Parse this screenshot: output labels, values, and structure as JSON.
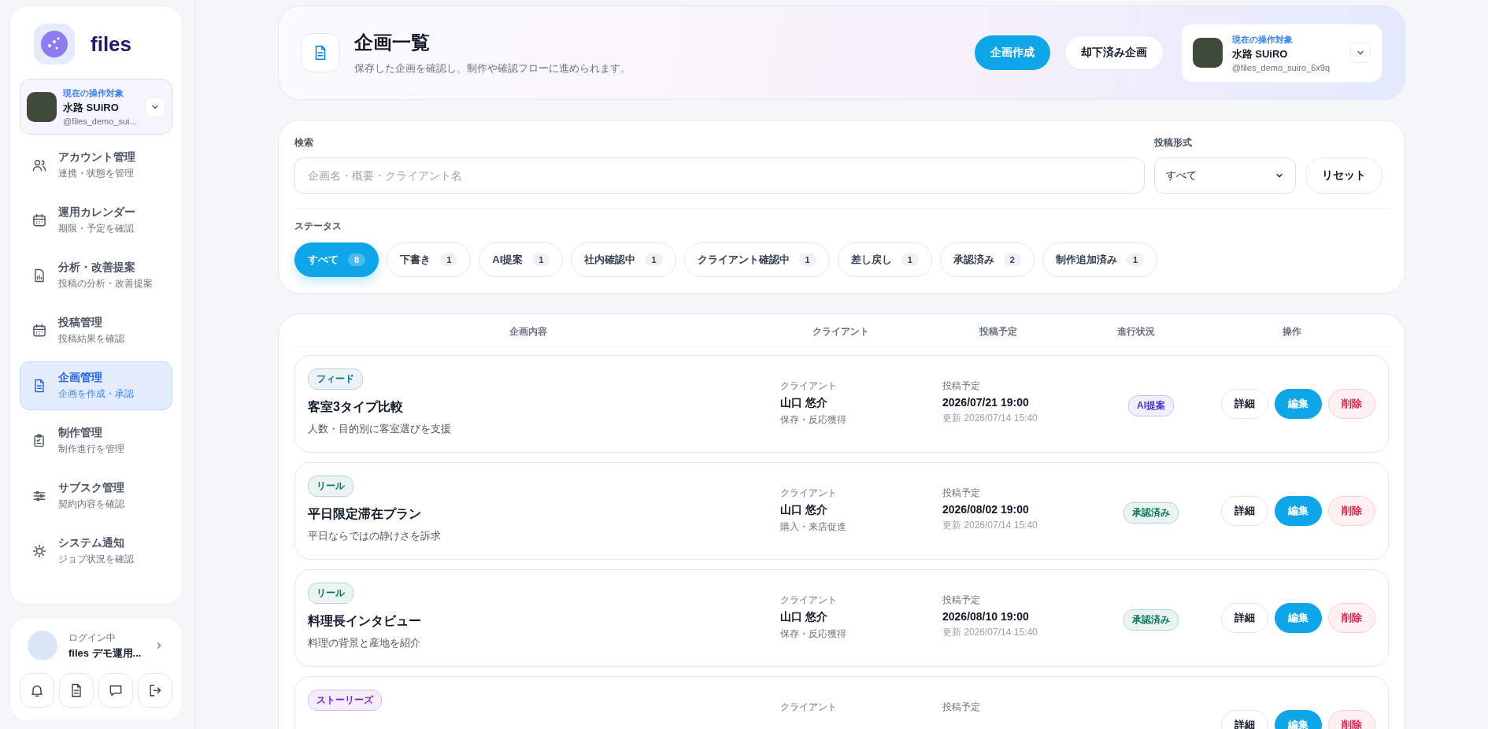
{
  "sidebar": {
    "logo": "files",
    "account": {
      "label": "現在の操作対象",
      "name": "水路 SUiRO",
      "handle": "@files_demo_sui..."
    },
    "items": [
      {
        "title": "アカウント管理",
        "subtitle": "連携・状態を管理",
        "selected": false
      },
      {
        "title": "運用カレンダー",
        "subtitle": "期限・予定を確認",
        "selected": false
      },
      {
        "title": "分析・改善提案",
        "subtitle": "投稿の分析・改善提案",
        "selected": false
      },
      {
        "title": "投稿管理",
        "subtitle": "投稿結果を確認",
        "selected": false
      },
      {
        "title": "企画管理",
        "subtitle": "企画を作成・承認",
        "selected": true
      },
      {
        "title": "制作管理",
        "subtitle": "制作進行を管理",
        "selected": false
      },
      {
        "title": "サブスク管理",
        "subtitle": "契約内容を確認",
        "selected": false
      },
      {
        "title": "システム通知",
        "subtitle": "ジョブ状況を確認",
        "selected": false
      }
    ],
    "user": {
      "label": "ログイン中",
      "name": "files デモ運用..."
    }
  },
  "header": {
    "title": "企画一覧",
    "subtitle": "保存した企画を確認し、制作や確認フローに進められます。",
    "primary_button": "企画作成",
    "secondary_button": "却下済み企画",
    "account": {
      "label": "現在の操作対象",
      "name": "水路 SUiRO",
      "handle": "@files_demo_suiro_6x9q"
    }
  },
  "filters": {
    "search_label": "検索",
    "search_placeholder": "企画名・概要・クライアント名",
    "format_label": "投稿形式",
    "format_value": "すべて",
    "reset_button": "リセット",
    "status_label": "ステータス",
    "chips": [
      {
        "label": "すべて",
        "count": "8",
        "selected": true
      },
      {
        "label": "下書き",
        "count": "1",
        "selected": false
      },
      {
        "label": "AI提案",
        "count": "1",
        "selected": false
      },
      {
        "label": "社内確認中",
        "count": "1",
        "selected": false
      },
      {
        "label": "クライアント確認中",
        "count": "1",
        "selected": false
      },
      {
        "label": "差し戻し",
        "count": "1",
        "selected": false
      },
      {
        "label": "承認済み",
        "count": "2",
        "selected": false
      },
      {
        "label": "制作追加済み",
        "count": "1",
        "selected": false
      }
    ]
  },
  "table": {
    "columns": [
      "企画内容",
      "クライアント",
      "投稿予定",
      "進行状況",
      "操作"
    ],
    "rows": [
      {
        "tag": {
          "label": "フィード",
          "color": "#0369a1"
        },
        "title": "客室3タイプ比較",
        "summary": "人数・目的別に客室選びを支援",
        "client_label": "クライアント",
        "client": "山口 悠介",
        "goal": "保存・反応獲得",
        "date_label": "投稿予定",
        "date": "2026/07/21 19:00",
        "updated": "更新 2026/07/14 15:40",
        "status": {
          "label": "AI提案",
          "color": "#4338ca"
        },
        "actions": [
          "詳細",
          "編集",
          "削除"
        ]
      },
      {
        "tag": {
          "label": "リール",
          "color": "#047857"
        },
        "title": "平日限定滞在プラン",
        "summary": "平日ならではの静けさを訴求",
        "client_label": "クライアント",
        "client": "山口 悠介",
        "goal": "購入・来店促進",
        "date_label": "投稿予定",
        "date": "2026/08/02 19:00",
        "updated": "更新 2026/07/14 15:40",
        "status": {
          "label": "承認済み",
          "color": "#047857"
        },
        "actions": [
          "詳細",
          "編集",
          "削除"
        ]
      },
      {
        "tag": {
          "label": "リール",
          "color": "#047857"
        },
        "title": "料理長インタビュー",
        "summary": "料理の背景と産地を紹介",
        "client_label": "クライアント",
        "client": "山口 悠介",
        "goal": "保存・反応獲得",
        "date_label": "投稿予定",
        "date": "2026/08/10 19:00",
        "updated": "更新 2026/07/14 15:40",
        "status": {
          "label": "承認済み",
          "color": "#047857"
        },
        "actions": [
          "詳細",
          "編集",
          "削除"
        ]
      },
      {
        "tag": {
          "label": "ストーリーズ",
          "color": "#7e22ce"
        },
        "client_label": "クライアント",
        "date_label": "投稿予定",
        "actions": [
          "詳細",
          "編集",
          "削除"
        ]
      }
    ]
  }
}
